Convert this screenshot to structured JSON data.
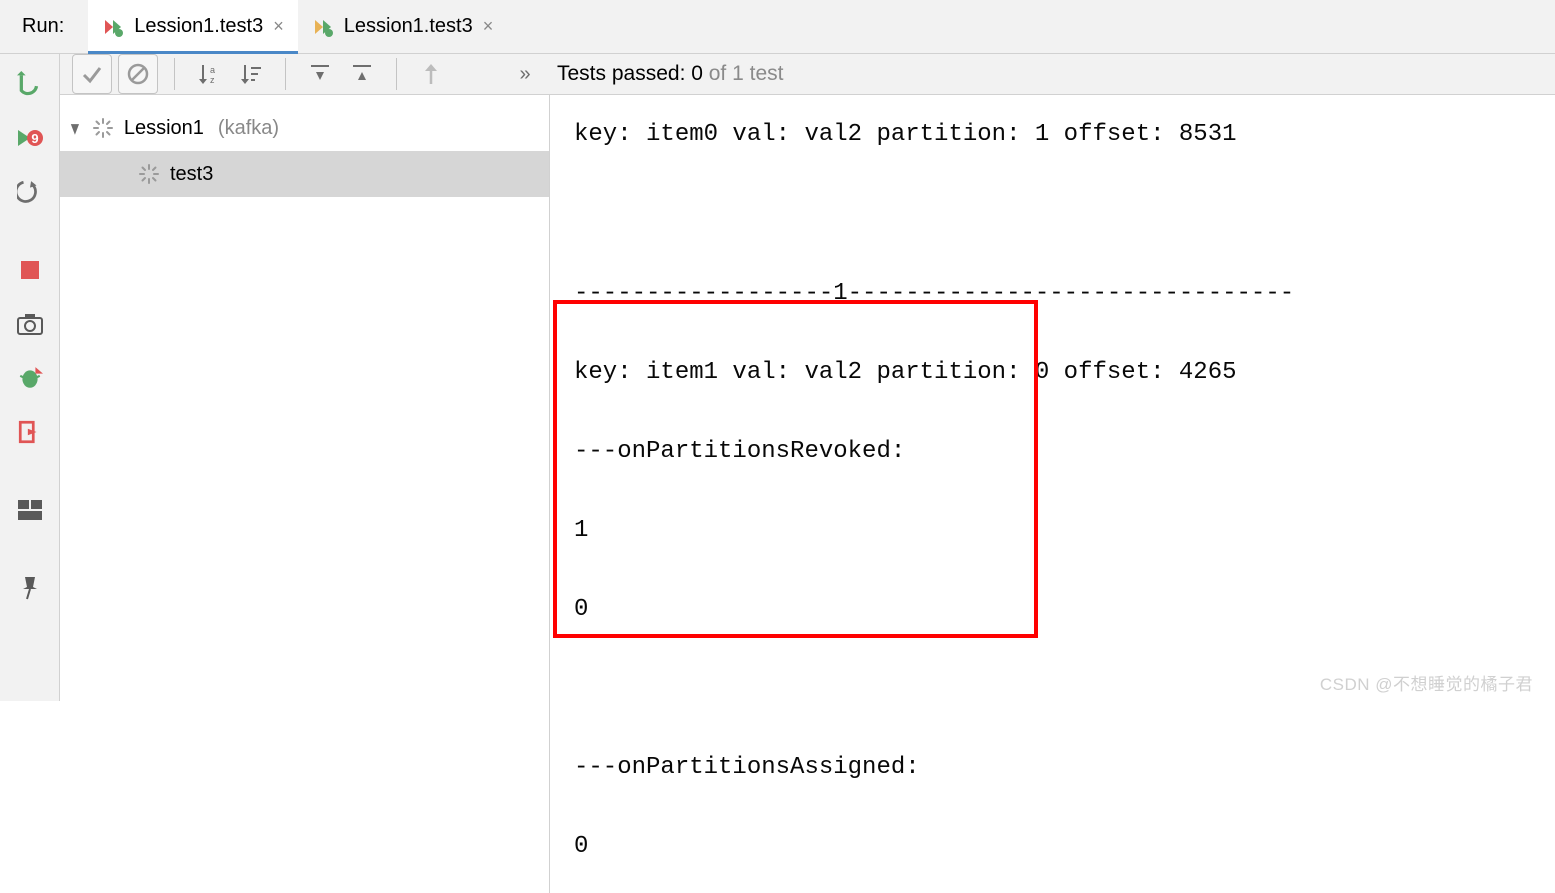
{
  "header": {
    "run_label": "Run:",
    "tabs": [
      {
        "label": "Lession1.test3",
        "active": true
      },
      {
        "label": "Lession1.test3",
        "active": false
      }
    ]
  },
  "toolbar": {
    "tests_passed_prefix": "Tests passed: ",
    "tests_passed_count": "0",
    "tests_passed_suffix": " of 1 test"
  },
  "tree": {
    "root_label": "Lession1",
    "root_context": "(kafka)",
    "child_label": "test3"
  },
  "console": {
    "lines": [
      "key: item0 val: val2 partition: 1 offset: 8531",
      "",
      "------------------1-------------------------------",
      "key: item1 val: val2 partition: 0 offset: 4265",
      "---onPartitionsRevoked:",
      "1",
      "0",
      "",
      "---onPartitionsAssigned:",
      "0"
    ]
  },
  "watermark": "CSDN @不想睡觉的橘子君",
  "icons": {
    "tab_test": "test-icon",
    "close": "×",
    "check": "✓",
    "stop_circle": "⊘",
    "sort_az": "↓ᵃᶻ",
    "rerun": "rerun-icon",
    "rerun_failed": "rerun-failed-icon",
    "toggle_auto": "toggle-auto-icon",
    "stop_square": "stop-icon",
    "camera": "camera-icon",
    "bug": "bug-icon",
    "exit": "exit-icon",
    "layout": "layout-icon",
    "pin": "pin-icon",
    "expand": "expand-icon",
    "collapse": "collapse-icon",
    "up": "↑",
    "more": "»",
    "spinner": "spinner-icon"
  }
}
